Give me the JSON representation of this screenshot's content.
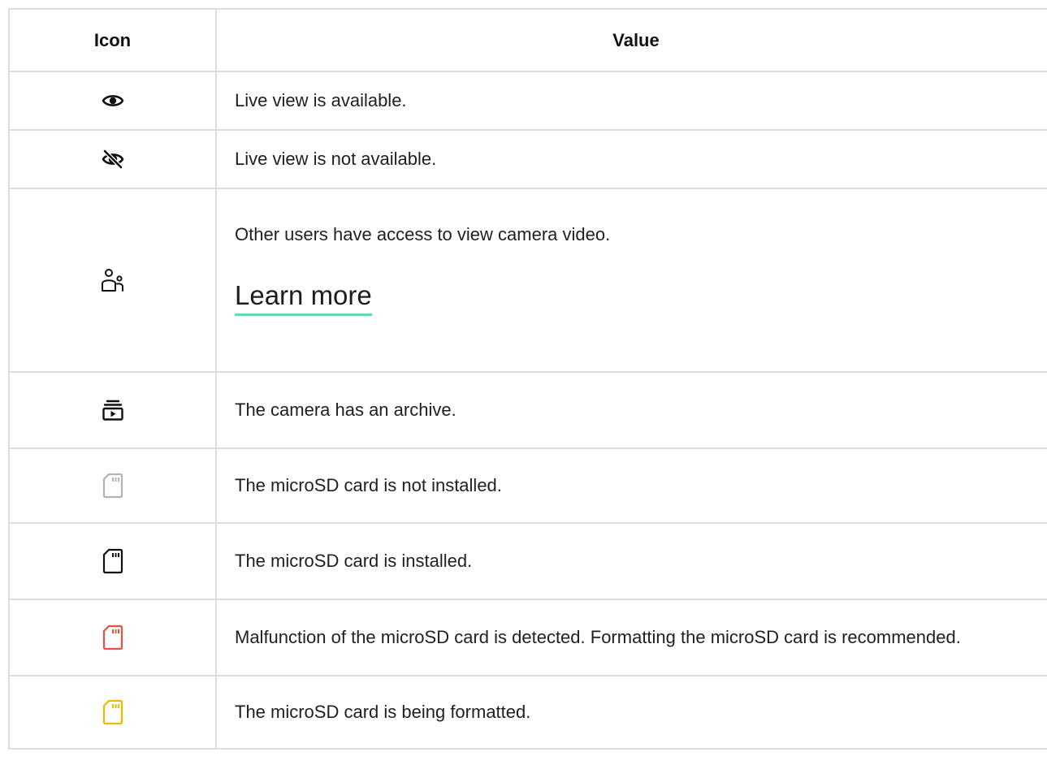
{
  "table": {
    "headers": {
      "icon": "Icon",
      "value": "Value"
    },
    "rows": [
      {
        "icon": "eye-icon",
        "icon_color": "#111111",
        "text": "Live view is available."
      },
      {
        "icon": "eye-off-icon",
        "icon_color": "#111111",
        "text": "Live view is not available."
      },
      {
        "icon": "users-icon",
        "icon_color": "#111111",
        "text": "Other users have access to view camera video.",
        "link": "Learn more"
      },
      {
        "icon": "archive-icon",
        "icon_color": "#111111",
        "text": "The camera has an archive."
      },
      {
        "icon": "sd-card-icon",
        "icon_color": "#b3b3b3",
        "text": "The microSD card is not installed."
      },
      {
        "icon": "sd-card-icon",
        "icon_color": "#111111",
        "text": "The microSD card is installed."
      },
      {
        "icon": "sd-card-icon",
        "icon_color": "#e8503f",
        "text": "Malfunction of the microSD card is detected. Formatting the microSD card is recommended."
      },
      {
        "icon": "sd-card-icon",
        "icon_color": "#f1b800",
        "text": "The microSD card is being formatted."
      }
    ]
  },
  "colors": {
    "link_underline": "#63dbb0",
    "border": "#dedede"
  }
}
